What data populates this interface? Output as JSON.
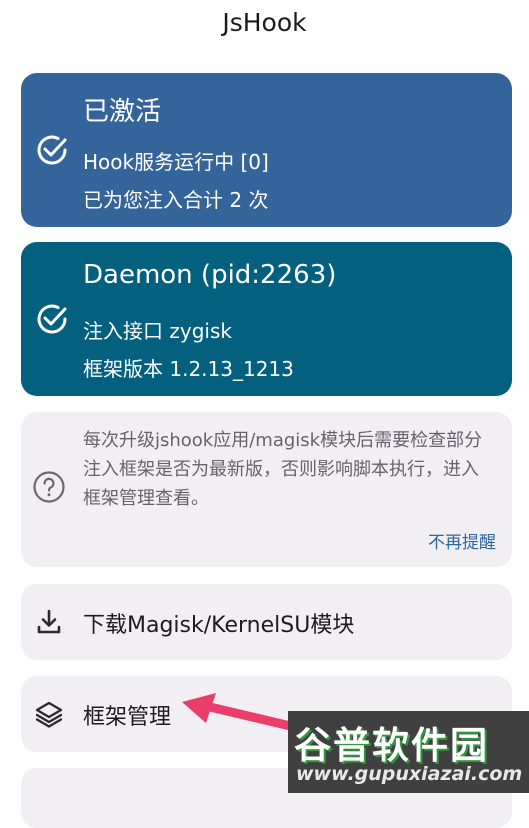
{
  "app": {
    "title": "JsHook"
  },
  "status_card": {
    "title": "已激活",
    "line1": "Hook服务运行中 [0]",
    "line2": "已为您注入合计 2 次",
    "icon": "check-circle-icon",
    "color": "#35649a"
  },
  "daemon_card": {
    "title": "Daemon (pid:2263)",
    "line1": "注入接口 zygisk",
    "line2": "框架版本 1.2.13_1213",
    "icon": "check-circle-icon",
    "color": "#04607f"
  },
  "notice": {
    "text": "每次升级jshook应用/magisk模块后需要检查部分注入框架是否为最新版，否则影响脚本执行，进入框架管理查看。",
    "dismiss_label": "不再提醒",
    "icon": "help-circle-icon"
  },
  "menu": {
    "items": [
      {
        "label": "下载Magisk/KernelSU模块",
        "icon": "download-icon"
      },
      {
        "label": "框架管理",
        "icon": "layers-icon"
      }
    ]
  },
  "watermark": {
    "top": "谷普软件园",
    "bottom": "www.gupuxiazai.com"
  }
}
